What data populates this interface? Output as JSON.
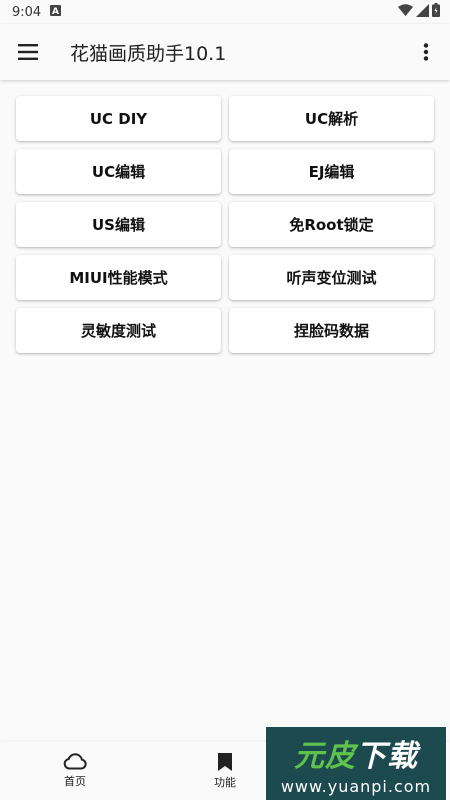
{
  "status_bar": {
    "time": "9:04",
    "icons": [
      "notification-a-icon",
      "wifi-icon",
      "signal-icon",
      "battery-icon"
    ]
  },
  "app_bar": {
    "title": "花猫画质助手10.1",
    "menu_icon": "hamburger-menu-icon",
    "more_icon": "more-vertical-icon"
  },
  "buttons": [
    {
      "label": "UC DIY"
    },
    {
      "label": "UC解析"
    },
    {
      "label": "UC编辑"
    },
    {
      "label": "EJ编辑"
    },
    {
      "label": "US编辑"
    },
    {
      "label": "免Root锁定"
    },
    {
      "label": "MIUI性能模式"
    },
    {
      "label": "听声变位测试"
    },
    {
      "label": "灵敏度测试"
    },
    {
      "label": "捏脸码数据"
    }
  ],
  "bottom_nav": {
    "items": [
      {
        "label": "首页",
        "icon": "cloud-icon"
      },
      {
        "label": "功能",
        "icon": "bookmark-icon"
      }
    ]
  },
  "watermark": {
    "title_part1": "元",
    "title_part2": "皮",
    "title_part3": "下载",
    "url": "www.yuanpi.com"
  }
}
